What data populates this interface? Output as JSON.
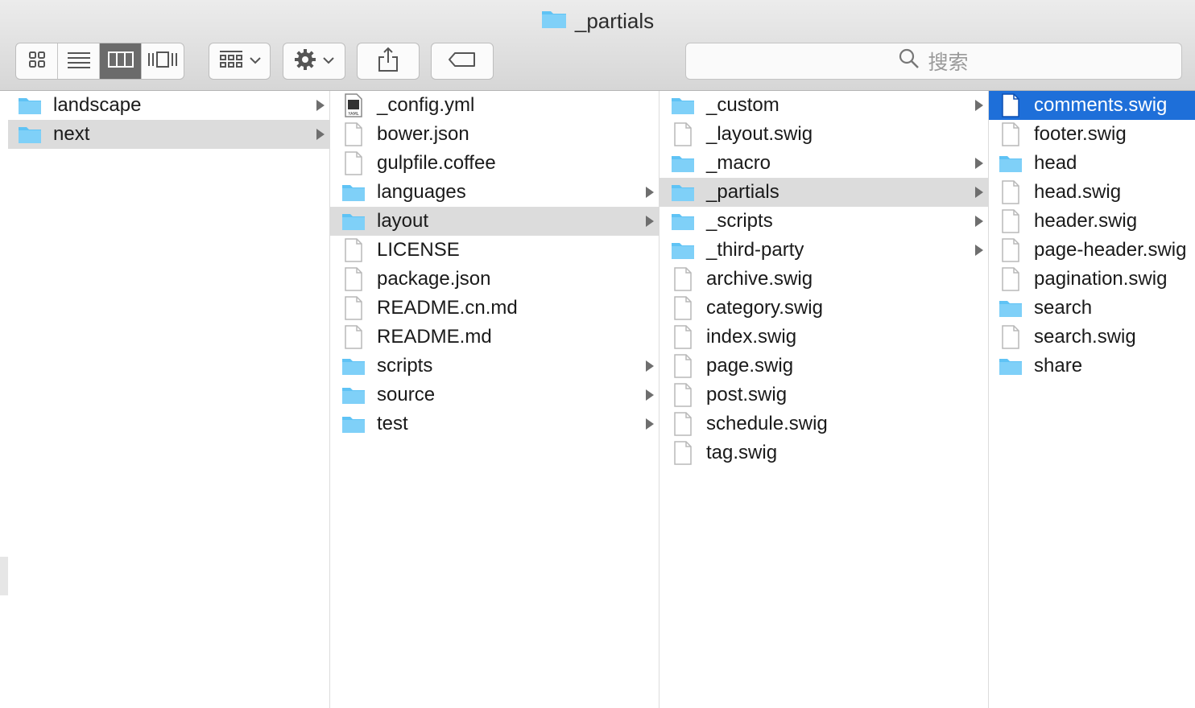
{
  "window": {
    "title": "_partials"
  },
  "toolbar": {
    "view_modes": [
      {
        "name": "icon-view-icon"
      },
      {
        "name": "list-view-icon"
      },
      {
        "name": "column-view-icon",
        "active": true
      },
      {
        "name": "cover-flow-icon"
      }
    ],
    "search_placeholder": "搜索"
  },
  "columns": {
    "col1": [
      {
        "label": "landscape",
        "kind": "folder",
        "arrow": true
      },
      {
        "label": "next",
        "kind": "folder",
        "arrow": true,
        "state": "selected"
      }
    ],
    "col2": [
      {
        "label": "_config.yml",
        "kind": "yaml"
      },
      {
        "label": "bower.json",
        "kind": "file"
      },
      {
        "label": "gulpfile.coffee",
        "kind": "file"
      },
      {
        "label": "languages",
        "kind": "folder",
        "arrow": true
      },
      {
        "label": "layout",
        "kind": "folder",
        "arrow": true,
        "state": "selected"
      },
      {
        "label": "LICENSE",
        "kind": "file"
      },
      {
        "label": "package.json",
        "kind": "file"
      },
      {
        "label": "README.cn.md",
        "kind": "file"
      },
      {
        "label": "README.md",
        "kind": "file"
      },
      {
        "label": "scripts",
        "kind": "folder",
        "arrow": true
      },
      {
        "label": "source",
        "kind": "folder",
        "arrow": true
      },
      {
        "label": "test",
        "kind": "folder",
        "arrow": true
      }
    ],
    "col3": [
      {
        "label": "_custom",
        "kind": "folder",
        "arrow": true
      },
      {
        "label": "_layout.swig",
        "kind": "file"
      },
      {
        "label": "_macro",
        "kind": "folder",
        "arrow": true
      },
      {
        "label": "_partials",
        "kind": "folder",
        "arrow": true,
        "state": "selected"
      },
      {
        "label": "_scripts",
        "kind": "folder",
        "arrow": true
      },
      {
        "label": "_third-party",
        "kind": "folder",
        "arrow": true
      },
      {
        "label": "archive.swig",
        "kind": "file"
      },
      {
        "label": "category.swig",
        "kind": "file"
      },
      {
        "label": "index.swig",
        "kind": "file"
      },
      {
        "label": "page.swig",
        "kind": "file"
      },
      {
        "label": "post.swig",
        "kind": "file"
      },
      {
        "label": "schedule.swig",
        "kind": "file"
      },
      {
        "label": "tag.swig",
        "kind": "file"
      }
    ],
    "col4": [
      {
        "label": "comments.swig",
        "kind": "file",
        "state": "active"
      },
      {
        "label": "footer.swig",
        "kind": "file"
      },
      {
        "label": "head",
        "kind": "folder"
      },
      {
        "label": "head.swig",
        "kind": "file"
      },
      {
        "label": "header.swig",
        "kind": "file"
      },
      {
        "label": "page-header.swig",
        "kind": "file"
      },
      {
        "label": "pagination.swig",
        "kind": "file"
      },
      {
        "label": "search",
        "kind": "folder"
      },
      {
        "label": "search.swig",
        "kind": "file"
      },
      {
        "label": "share",
        "kind": "folder"
      }
    ]
  },
  "colors": {
    "folder": "#5fc3f5",
    "selection": "#1e6fd9",
    "inactive_selection": "#dcdcdc"
  }
}
